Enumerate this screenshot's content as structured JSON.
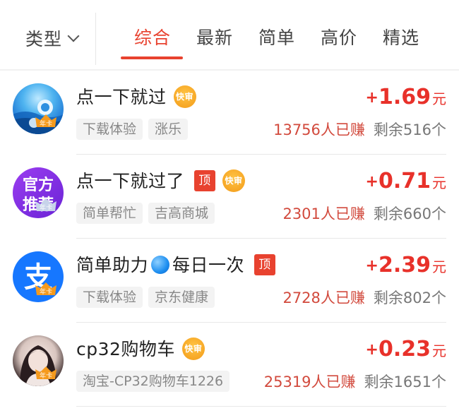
{
  "filter": {
    "type_label": "类型",
    "tabs": [
      "综合",
      "最新",
      "简单",
      "高价",
      "精选"
    ],
    "active_tab": "综合"
  },
  "badges": {
    "top": "顶",
    "fast": "快审",
    "year_card": "年卡"
  },
  "tasks": [
    {
      "title": "点一下就过",
      "avatar": "ocean-icon",
      "badges": [
        "fast"
      ],
      "price_sign": "+",
      "price": "1.69",
      "price_unit": "元",
      "tags": [
        "下载体验",
        "涨乐"
      ],
      "earned": "13756人已赚",
      "remaining": "剩余516个"
    },
    {
      "title": "点一下就过了",
      "avatar": "official-recommend-icon",
      "avatar_text": "官方推荐",
      "badges": [
        "top",
        "fast"
      ],
      "price_sign": "+",
      "price": "0.71",
      "price_unit": "元",
      "tags": [
        "简单帮忙",
        "吉高商城"
      ],
      "earned": "2301人已赚",
      "remaining": "剩余660个"
    },
    {
      "title_before": "简单助力",
      "title_after": "每日一次",
      "avatar": "alipay-icon",
      "avatar_text": "支",
      "badges": [
        "top"
      ],
      "price_sign": "+",
      "price": "2.39",
      "price_unit": "元",
      "tags": [
        "下载体验",
        "京东健康"
      ],
      "earned": "2728人已赚",
      "remaining": "剩余802个"
    },
    {
      "title": "cp32购物车",
      "avatar": "girl-photo-icon",
      "badges": [
        "fast"
      ],
      "price_sign": "+",
      "price": "0.23",
      "price_unit": "元",
      "tags": [
        "淘宝-CP32购物车1226"
      ],
      "earned": "25319人已赚",
      "remaining": "剩余1651个"
    }
  ],
  "colors": {
    "accent": "#e8422f",
    "price": "#e8312a",
    "tag_bg": "#f3f3f3"
  }
}
